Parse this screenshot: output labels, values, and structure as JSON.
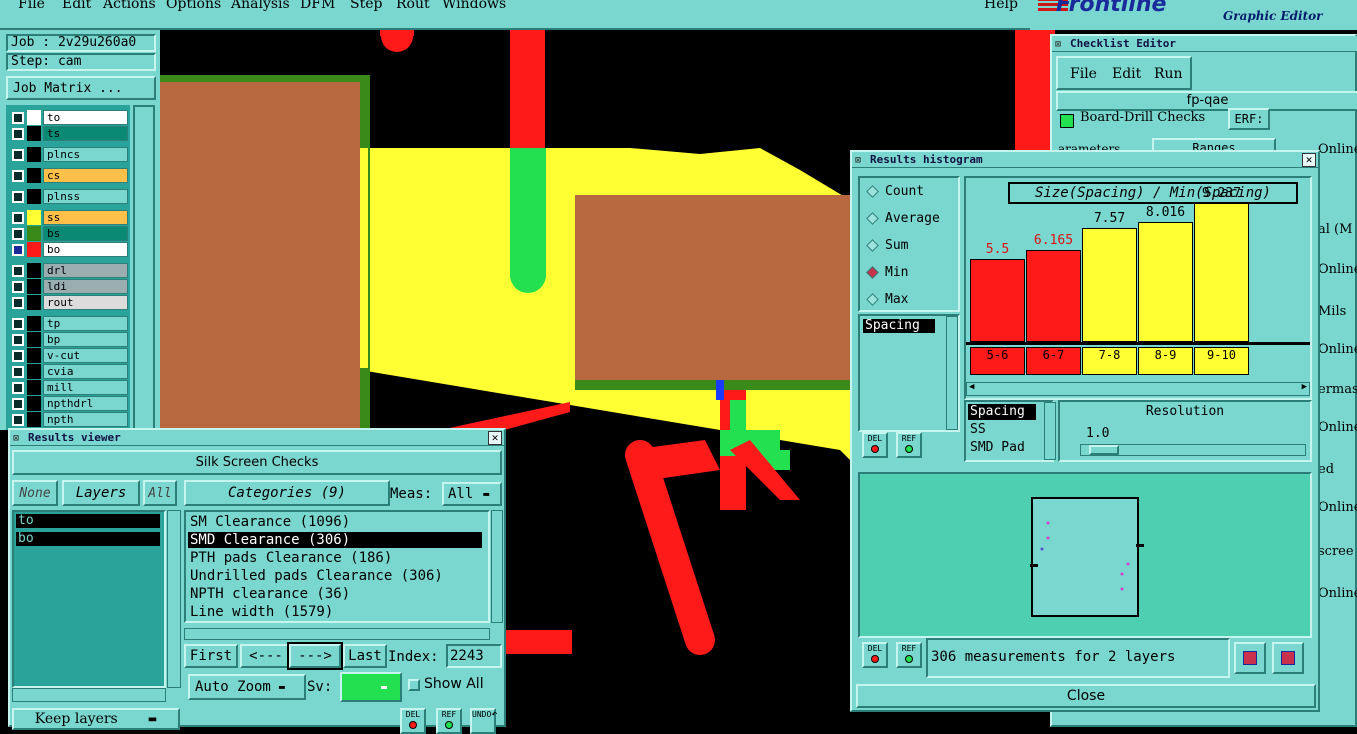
{
  "menubar": {
    "items": [
      "File",
      "Edit",
      "Actions",
      "Options",
      "Analysis",
      "DFM",
      "Step",
      "Rout",
      "Windows"
    ],
    "help": "Help"
  },
  "brand": {
    "logo": "Frontline",
    "subtitle": "Graphic Editor",
    "color": "#d01515"
  },
  "job": {
    "job_label": "Job : 2v29u260a0",
    "step_label": "Step: cam",
    "matrix_button": "Job Matrix ..."
  },
  "layers": [
    {
      "name": "to",
      "swatch": "#ffffff",
      "bg": "#ffffff"
    },
    {
      "name": "ts",
      "swatch": "#000000",
      "bg": "#0a8a74"
    },
    {
      "name": "plncs",
      "swatch": "#000000",
      "bg": "#7ad7cf"
    },
    {
      "name": "cs",
      "swatch": "#000000",
      "bg": "#ffc04a"
    },
    {
      "name": "plnss",
      "swatch": "#000000",
      "bg": "#7ad7cf"
    },
    {
      "name": "ss",
      "swatch": "#ffff33",
      "bg": "#ffc04a"
    },
    {
      "name": "bs",
      "swatch": "#3a8a1a",
      "bg": "#0a8a74"
    },
    {
      "name": "bo",
      "swatch": "#ff1a1a",
      "bg": "#ffffff"
    },
    {
      "name": "drl",
      "swatch": "#000000",
      "bg": "#9aaeb0"
    },
    {
      "name": "ldi",
      "swatch": "#000000",
      "bg": "#9aaeb0"
    },
    {
      "name": "rout",
      "swatch": "#000000",
      "bg": "#dcdcdc"
    },
    {
      "name": "tp",
      "swatch": "#000000",
      "bg": "#7ad7cf"
    },
    {
      "name": "bp",
      "swatch": "#000000",
      "bg": "#7ad7cf"
    },
    {
      "name": "v-cut",
      "swatch": "#000000",
      "bg": "#7ad7cf"
    },
    {
      "name": "cvia",
      "swatch": "#000000",
      "bg": "#7ad7cf"
    },
    {
      "name": "mill",
      "swatch": "#000000",
      "bg": "#7ad7cf"
    },
    {
      "name": "npthdrl",
      "swatch": "#000000",
      "bg": "#7ad7cf"
    },
    {
      "name": "npth",
      "swatch": "#000000",
      "bg": "#7ad7cf"
    }
  ],
  "results_viewer": {
    "title": "Results viewer",
    "header": "Silk Screen Checks",
    "none_btn": "None",
    "layers_btn": "Layers",
    "all_btn": "All",
    "layer_list": [
      "to",
      "bo"
    ],
    "categories_btn": "Categories (9)",
    "meas_label": "Meas:",
    "meas_value": "All",
    "categories": [
      "SM Clearance (1096)",
      "SMD Clearance (306)",
      "PTH pads Clearance (186)",
      "Undrilled pads Clearance (306)",
      "NPTH clearance (36)",
      "Line width (1579)"
    ],
    "selected_category": 1,
    "first_btn": "First",
    "prev_btn": "<---",
    "next_btn": "--->",
    "last_btn": "Last",
    "index_label": "Index:",
    "index_value": "2243",
    "zoom_value": "Auto Zoom",
    "sv_label": "Sv:",
    "show_all": "Show All",
    "keep_layers": "Keep layers",
    "del": "DEL",
    "ref": "REF",
    "undo": "UNDO"
  },
  "checklist_editor": {
    "title": "Checklist Editor",
    "menu": [
      "File",
      "Edit",
      "Run"
    ],
    "name": "fp-qae",
    "row_text": "Board-Drill Checks",
    "erf": "ERF:",
    "parameters": "arameters",
    "ranges": "Ranges",
    "side_labels": [
      "Online",
      "al (M",
      "Online",
      "Mils",
      "Online",
      "ermas",
      "Online",
      "ed",
      "Online",
      "scree",
      "Online"
    ]
  },
  "histogram": {
    "title": "Results histogram",
    "modes": [
      "Count",
      "Average",
      "Sum",
      "Min",
      "Max"
    ],
    "selected_mode": 3,
    "measure_list": [
      "Spacing"
    ],
    "chart_title": "Size(Spacing) / Min(Spacing)",
    "resolution_label": "Resolution",
    "resolution_value": "1.0",
    "types": [
      "Spacing",
      "SS",
      "SMD Pad"
    ],
    "status": "306 measurements for 2 layers",
    "close": "Close",
    "del": "DEL",
    "ref": "REF"
  },
  "chart_data": {
    "type": "bar",
    "title": "Size(Spacing) / Min(Spacing)",
    "categories": [
      "5-6",
      "6-7",
      "7-8",
      "8-9",
      "9-10"
    ],
    "values": [
      5.5,
      6.165,
      7.57,
      8.016,
      9.237
    ],
    "value_labels": [
      "5.5",
      "6.165",
      "7.57",
      "8.016",
      "9.237"
    ],
    "colors": [
      "#ff1a1a",
      "#ff1a1a",
      "#ffff33",
      "#ffff33",
      "#ffff33"
    ],
    "ylim": [
      0,
      10
    ]
  }
}
